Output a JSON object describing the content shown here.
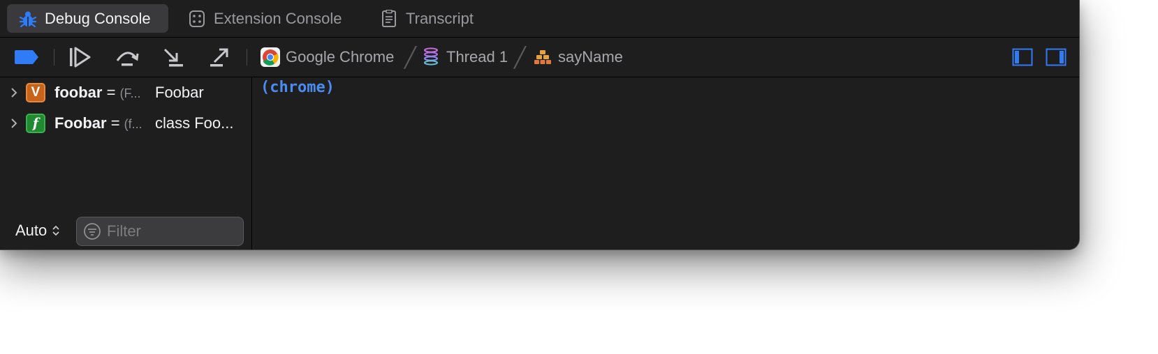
{
  "tabs": [
    {
      "label": "Debug Console",
      "icon": "bug-icon",
      "active": true
    },
    {
      "label": "Extension Console",
      "icon": "extension-icon",
      "active": false
    },
    {
      "label": "Transcript",
      "icon": "document-icon",
      "active": false
    }
  ],
  "toolbar": {
    "icons": [
      "breakpoint-toggle-icon",
      "continue-icon",
      "step-over-icon",
      "step-into-icon",
      "step-out-icon"
    ],
    "breadcrumb": [
      {
        "label": "Google Chrome",
        "icon": "chrome-icon"
      },
      {
        "label": "Thread 1",
        "icon": "thread-icon"
      },
      {
        "label": "sayName",
        "icon": "stack-frame-icon"
      }
    ],
    "right_icons": [
      "show-left-pane-icon",
      "show-right-pane-icon"
    ]
  },
  "variables": [
    {
      "kind": "V",
      "name": "foobar",
      "eq": "=",
      "type": "(F...",
      "value": "Foobar"
    },
    {
      "kind": "f",
      "name": "Foobar",
      "eq": "=",
      "type": "(f...",
      "value": "class Foo..."
    }
  ],
  "scope_selector": "Auto",
  "filter": {
    "placeholder": "Filter",
    "value": ""
  },
  "console": {
    "lines": [
      "(chrome)"
    ]
  },
  "colors": {
    "accent": "#4a8cf0",
    "background": "#1e1e1f",
    "active_tab": "#3a3a3d"
  }
}
